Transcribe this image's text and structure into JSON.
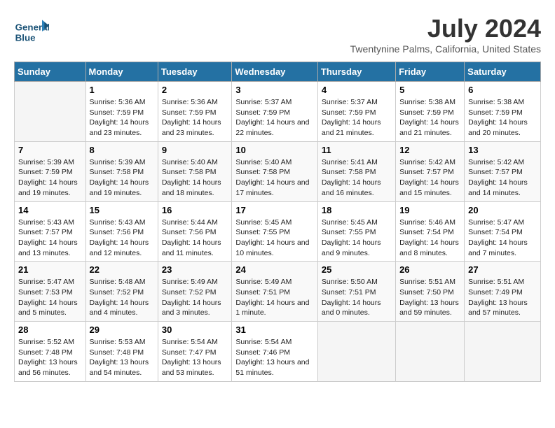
{
  "header": {
    "logo_line1": "General",
    "logo_line2": "Blue",
    "month_year": "July 2024",
    "location": "Twentynine Palms, California, United States"
  },
  "days_of_week": [
    "Sunday",
    "Monday",
    "Tuesday",
    "Wednesday",
    "Thursday",
    "Friday",
    "Saturday"
  ],
  "weeks": [
    [
      {
        "day": "",
        "info": ""
      },
      {
        "day": "1",
        "info": "Sunrise: 5:36 AM\nSunset: 7:59 PM\nDaylight: 14 hours\nand 23 minutes."
      },
      {
        "day": "2",
        "info": "Sunrise: 5:36 AM\nSunset: 7:59 PM\nDaylight: 14 hours\nand 23 minutes."
      },
      {
        "day": "3",
        "info": "Sunrise: 5:37 AM\nSunset: 7:59 PM\nDaylight: 14 hours\nand 22 minutes."
      },
      {
        "day": "4",
        "info": "Sunrise: 5:37 AM\nSunset: 7:59 PM\nDaylight: 14 hours\nand 21 minutes."
      },
      {
        "day": "5",
        "info": "Sunrise: 5:38 AM\nSunset: 7:59 PM\nDaylight: 14 hours\nand 21 minutes."
      },
      {
        "day": "6",
        "info": "Sunrise: 5:38 AM\nSunset: 7:59 PM\nDaylight: 14 hours\nand 20 minutes."
      }
    ],
    [
      {
        "day": "7",
        "info": "Sunrise: 5:39 AM\nSunset: 7:59 PM\nDaylight: 14 hours\nand 19 minutes."
      },
      {
        "day": "8",
        "info": "Sunrise: 5:39 AM\nSunset: 7:58 PM\nDaylight: 14 hours\nand 19 minutes."
      },
      {
        "day": "9",
        "info": "Sunrise: 5:40 AM\nSunset: 7:58 PM\nDaylight: 14 hours\nand 18 minutes."
      },
      {
        "day": "10",
        "info": "Sunrise: 5:40 AM\nSunset: 7:58 PM\nDaylight: 14 hours\nand 17 minutes."
      },
      {
        "day": "11",
        "info": "Sunrise: 5:41 AM\nSunset: 7:58 PM\nDaylight: 14 hours\nand 16 minutes."
      },
      {
        "day": "12",
        "info": "Sunrise: 5:42 AM\nSunset: 7:57 PM\nDaylight: 14 hours\nand 15 minutes."
      },
      {
        "day": "13",
        "info": "Sunrise: 5:42 AM\nSunset: 7:57 PM\nDaylight: 14 hours\nand 14 minutes."
      }
    ],
    [
      {
        "day": "14",
        "info": "Sunrise: 5:43 AM\nSunset: 7:57 PM\nDaylight: 14 hours\nand 13 minutes."
      },
      {
        "day": "15",
        "info": "Sunrise: 5:43 AM\nSunset: 7:56 PM\nDaylight: 14 hours\nand 12 minutes."
      },
      {
        "day": "16",
        "info": "Sunrise: 5:44 AM\nSunset: 7:56 PM\nDaylight: 14 hours\nand 11 minutes."
      },
      {
        "day": "17",
        "info": "Sunrise: 5:45 AM\nSunset: 7:55 PM\nDaylight: 14 hours\nand 10 minutes."
      },
      {
        "day": "18",
        "info": "Sunrise: 5:45 AM\nSunset: 7:55 PM\nDaylight: 14 hours\nand 9 minutes."
      },
      {
        "day": "19",
        "info": "Sunrise: 5:46 AM\nSunset: 7:54 PM\nDaylight: 14 hours\nand 8 minutes."
      },
      {
        "day": "20",
        "info": "Sunrise: 5:47 AM\nSunset: 7:54 PM\nDaylight: 14 hours\nand 7 minutes."
      }
    ],
    [
      {
        "day": "21",
        "info": "Sunrise: 5:47 AM\nSunset: 7:53 PM\nDaylight: 14 hours\nand 5 minutes."
      },
      {
        "day": "22",
        "info": "Sunrise: 5:48 AM\nSunset: 7:52 PM\nDaylight: 14 hours\nand 4 minutes."
      },
      {
        "day": "23",
        "info": "Sunrise: 5:49 AM\nSunset: 7:52 PM\nDaylight: 14 hours\nand 3 minutes."
      },
      {
        "day": "24",
        "info": "Sunrise: 5:49 AM\nSunset: 7:51 PM\nDaylight: 14 hours\nand 1 minute."
      },
      {
        "day": "25",
        "info": "Sunrise: 5:50 AM\nSunset: 7:51 PM\nDaylight: 14 hours\nand 0 minutes."
      },
      {
        "day": "26",
        "info": "Sunrise: 5:51 AM\nSunset: 7:50 PM\nDaylight: 13 hours\nand 59 minutes."
      },
      {
        "day": "27",
        "info": "Sunrise: 5:51 AM\nSunset: 7:49 PM\nDaylight: 13 hours\nand 57 minutes."
      }
    ],
    [
      {
        "day": "28",
        "info": "Sunrise: 5:52 AM\nSunset: 7:48 PM\nDaylight: 13 hours\nand 56 minutes."
      },
      {
        "day": "29",
        "info": "Sunrise: 5:53 AM\nSunset: 7:48 PM\nDaylight: 13 hours\nand 54 minutes."
      },
      {
        "day": "30",
        "info": "Sunrise: 5:54 AM\nSunset: 7:47 PM\nDaylight: 13 hours\nand 53 minutes."
      },
      {
        "day": "31",
        "info": "Sunrise: 5:54 AM\nSunset: 7:46 PM\nDaylight: 13 hours\nand 51 minutes."
      },
      {
        "day": "",
        "info": ""
      },
      {
        "day": "",
        "info": ""
      },
      {
        "day": "",
        "info": ""
      }
    ]
  ]
}
